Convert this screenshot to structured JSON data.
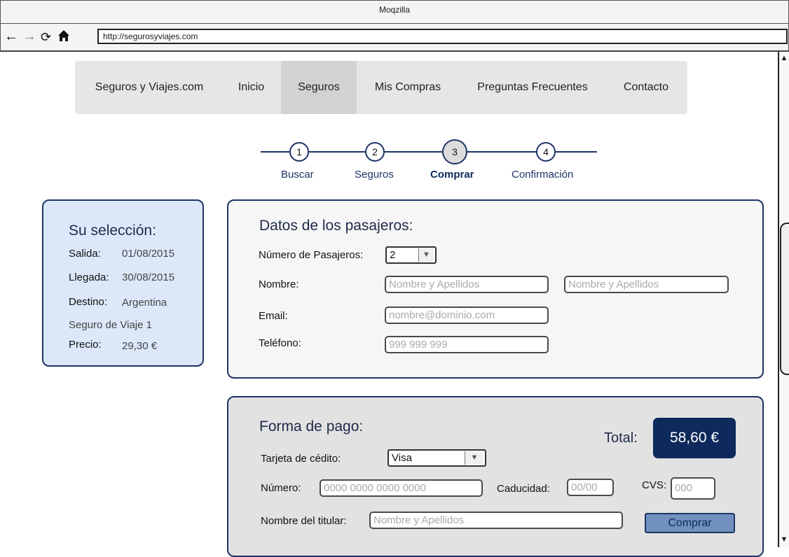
{
  "browser": {
    "title": "Moqzilla",
    "url": "http://segurosyviajes.com",
    "icons": [
      "back-arrow-icon",
      "forward-arrow-icon",
      "reload-icon",
      "home-icon"
    ]
  },
  "nav": {
    "brand": "Seguros y Viajes.com",
    "items": [
      "Inicio",
      "Seguros",
      "Mis Compras",
      "Preguntas Frecuentes",
      "Contacto"
    ],
    "active": "Seguros"
  },
  "steps": [
    {
      "num": "1",
      "label": "Buscar"
    },
    {
      "num": "2",
      "label": "Seguros"
    },
    {
      "num": "3",
      "label": "Comprar"
    },
    {
      "num": "4",
      "label": "Confirmación"
    }
  ],
  "selection": {
    "title": "Su selección:",
    "salida_label": "Salida:",
    "salida": "01/08/2015",
    "llegada_label": "Llegada:",
    "llegada": "30/08/2015",
    "destino_label": "Destino:",
    "destino": "Argentina",
    "seguro": "Seguro de Viaje 1",
    "precio_label": "Precio:",
    "precio": "29,30 €"
  },
  "passengers": {
    "title": "Datos de los pasajeros:",
    "num_label": "Número de Pasajeros:",
    "num_value": "2",
    "name_label": "Nombre:",
    "name_placeholder": "Nombre y Apellidos",
    "email_label": "Email:",
    "email_placeholder": "nombre@dominio.com",
    "phone_label": "Teléfono:",
    "phone_placeholder": "999 999 999"
  },
  "payment": {
    "title": "Forma de pago:",
    "total_label": "Total:",
    "total": "58,60 €",
    "card_label": "Tarjeta de cédito:",
    "card_value": "Visa",
    "number_label": "Número:",
    "number_placeholder": "0000 0000 0000 0000",
    "expiry_label": "Caducidad:",
    "expiry_placeholder": "00/00",
    "cvs_label": "CVS:",
    "cvs_placeholder": "000",
    "holder_label": "Nombre del titular:",
    "holder_placeholder": "Nombre y Apellidos",
    "buy_label": "Comprar"
  },
  "colors": {
    "accent": "#1e3466",
    "total_bg": "#0e2a5c",
    "button": "#7190bd",
    "selection_bg": "#dce8fa"
  }
}
